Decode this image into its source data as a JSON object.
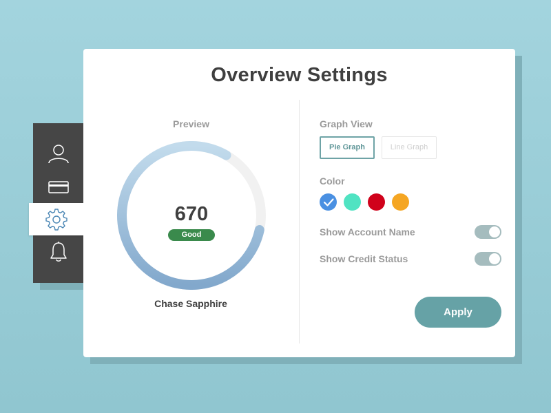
{
  "sidebar": {
    "items": [
      {
        "icon": "user-icon",
        "active": false
      },
      {
        "icon": "credit-card-icon",
        "active": false
      },
      {
        "icon": "gear-icon",
        "active": true
      },
      {
        "icon": "bell-icon",
        "active": false
      }
    ]
  },
  "card": {
    "title": "Overview Settings"
  },
  "preview": {
    "label": "Preview",
    "score": "670",
    "status": "Good",
    "account_name": "Chase Sapphire",
    "gauge_fill_fraction": 0.8
  },
  "settings": {
    "graph_view": {
      "label": "Graph View",
      "options": [
        "Pie Graph",
        "Line Graph"
      ],
      "selected": "Pie Graph"
    },
    "color": {
      "label": "Color",
      "options": [
        "#4a90e2",
        "#50e3c2",
        "#d0021b",
        "#f5a623"
      ],
      "selected": "#4a90e2"
    },
    "show_account_name": {
      "label": "Show Account Name",
      "enabled": true
    },
    "show_credit_status": {
      "label": "Show Credit Status",
      "enabled": true
    },
    "apply_label": "Apply"
  },
  "colors": {
    "accent": "#66a2a6",
    "badge": "#3a8a4c",
    "gauge": "#87abcf",
    "sidebar_bg": "#464646"
  }
}
